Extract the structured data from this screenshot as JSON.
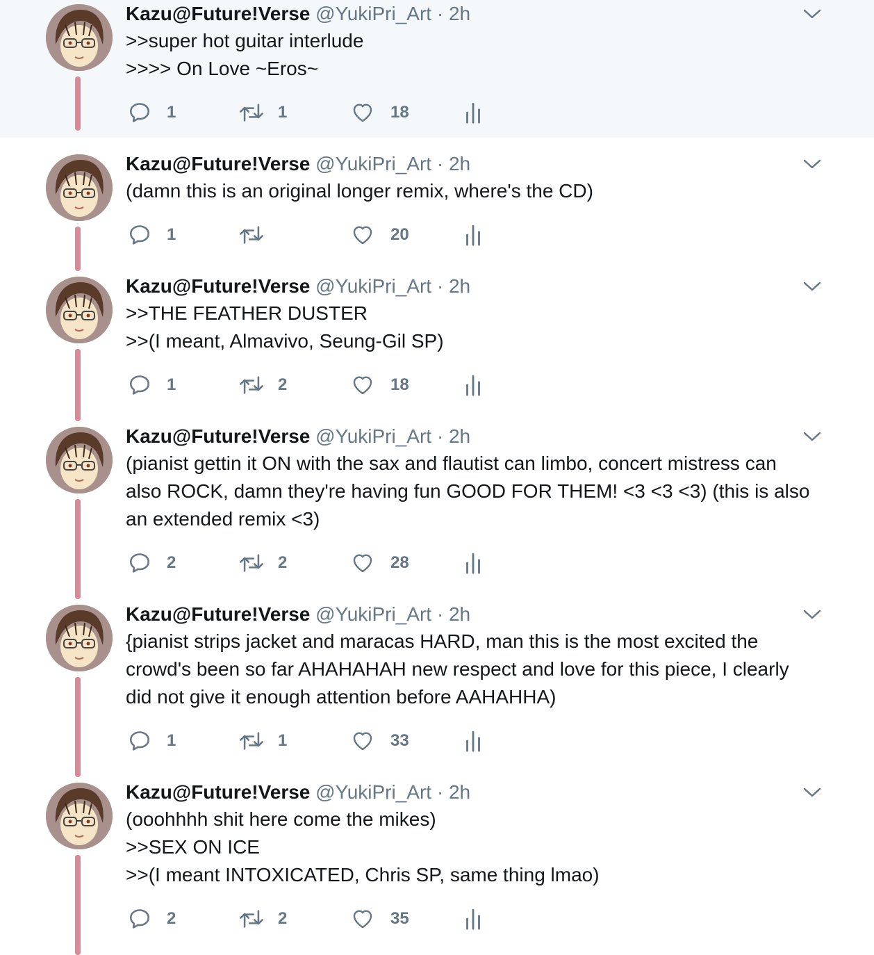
{
  "tweets": [
    {
      "name": "Kazu@Future!Verse",
      "handle": "@YukiPri_Art",
      "separator": "·",
      "time": "2h",
      "lines": [
        ">>super hot guitar interlude",
        ">>>> On Love ~Eros~"
      ],
      "replies": "1",
      "retweets": "1",
      "likes": "18"
    },
    {
      "name": "Kazu@Future!Verse",
      "handle": "@YukiPri_Art",
      "separator": "·",
      "time": "2h",
      "lines": [
        "(damn this is an original longer remix, where's the CD)"
      ],
      "replies": "1",
      "retweets": "",
      "likes": "20"
    },
    {
      "name": "Kazu@Future!Verse",
      "handle": "@YukiPri_Art",
      "separator": "·",
      "time": "2h",
      "lines": [
        ">>THE FEATHER DUSTER",
        ">>(I meant, Almavivo, Seung-Gil SP)"
      ],
      "replies": "1",
      "retweets": "2",
      "likes": "18"
    },
    {
      "name": "Kazu@Future!Verse",
      "handle": "@YukiPri_Art",
      "separator": "·",
      "time": "2h",
      "lines": [
        "(pianist gettin it ON with the sax and flautist can limbo, concert mistress can",
        "also ROCK, damn they're having fun GOOD FOR THEM! <3 <3 <3) (this is also",
        "an extended remix <3)"
      ],
      "replies": "2",
      "retweets": "2",
      "likes": "28"
    },
    {
      "name": "Kazu@Future!Verse",
      "handle": "@YukiPri_Art",
      "separator": "·",
      "time": "2h",
      "lines": [
        "{pianist strips jacket and maracas HARD, man this is the most excited the",
        "crowd's been so far AHAHAHAH new respect and love for this piece, I clearly",
        "did not give it enough attention before AAHAHHA)"
      ],
      "replies": "1",
      "retweets": "1",
      "likes": "33"
    },
    {
      "name": "Kazu@Future!Verse",
      "handle": "@YukiPri_Art",
      "separator": "·",
      "time": "2h",
      "lines": [
        "(ooohhhh shit here come the mikes)",
        ">>SEX ON ICE",
        ">>(I meant INTOXICATED, Chris SP, same thing lmao)"
      ],
      "replies": "2",
      "retweets": "2",
      "likes": "35"
    }
  ],
  "colors": {
    "thread_line": "#d58c98",
    "highlight_background": "#f5f8fa",
    "muted_text": "#657786",
    "text": "#14171a"
  },
  "icons": [
    "reply-icon",
    "retweet-icon",
    "like-icon",
    "analytics-icon",
    "chevron-down-icon",
    "avatar"
  ]
}
